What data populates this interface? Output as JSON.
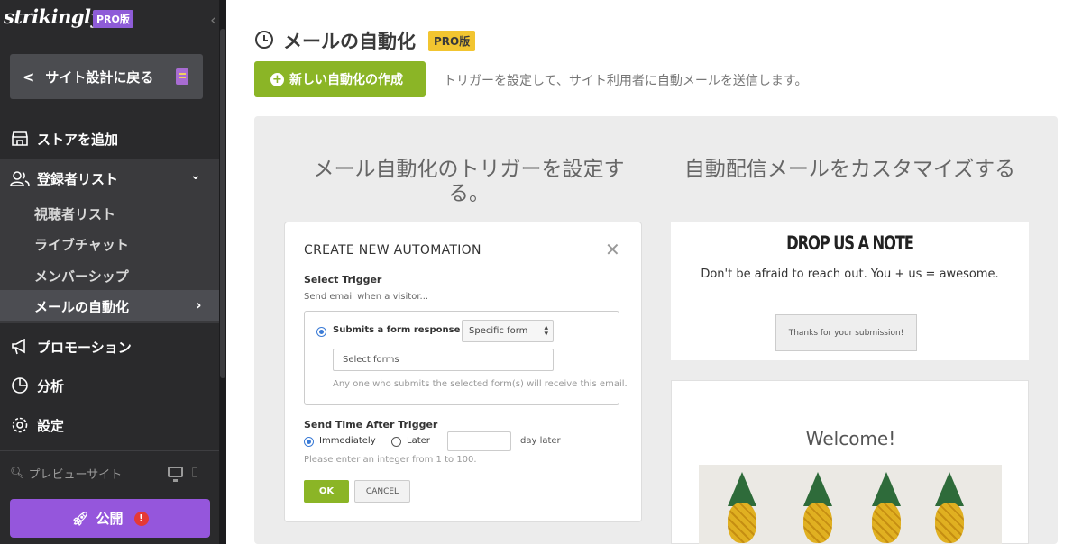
{
  "sidebar": {
    "logo": "strikingly",
    "logo_badge": "PRO版",
    "collapse_icon": "chevron-left-icon",
    "back_button": "サイト設計に戻る",
    "nav": {
      "store": "ストアを追加",
      "subscribers": "登録者リスト",
      "promotion": "プロモーション",
      "analytics": "分析",
      "settings": "設定"
    },
    "sub_items": [
      "視聴者リスト",
      "ライブチャット",
      "メンバーシップ",
      "メールの自動化"
    ],
    "active_sub_item": "メールの自動化",
    "preview": "プレビューサイト",
    "publish": "公開",
    "publish_alert": "!",
    "colors": {
      "background": "#2a2a2c",
      "publish": "#9556dc"
    }
  },
  "main": {
    "title": "メールの自動化",
    "title_badge": "PRO版",
    "create_button": "新しい自動化の作成",
    "create_description": "トリガーを設定して、サイト利用者に自動メールを送信します。",
    "panel": {
      "left_heading": "メール自動化のトリガーを設定する。",
      "right_heading": "自動配信メールをカスタマイズする"
    },
    "automation_card": {
      "title": "CREATE NEW AUTOMATION",
      "select_trigger_label": "Select Trigger",
      "select_trigger_sub": "Send email when a visitor...",
      "trigger_option": "Submits a form response to",
      "form_select_value": "Specific form",
      "forms_placeholder": "Select forms",
      "forms_hint": "Any one who submits the selected form(s) will receive this email.",
      "send_time_label": "Send Time After Trigger",
      "immediately": "Immediately",
      "later": "Later",
      "day_later": "day later",
      "integer_hint": "Please enter an integer  from 1 to 100.",
      "ok": "OK",
      "cancel": "CANCEL"
    },
    "note_card": {
      "title": "DROP US A NOTE",
      "text": "Don't be afraid to reach out. You + us = awesome.",
      "button": "Thanks for your submission!"
    },
    "welcome_card": {
      "title": "Welcome!"
    },
    "colors": {
      "accent_green": "#8bb526",
      "pro_badge": "#f2c530"
    }
  }
}
